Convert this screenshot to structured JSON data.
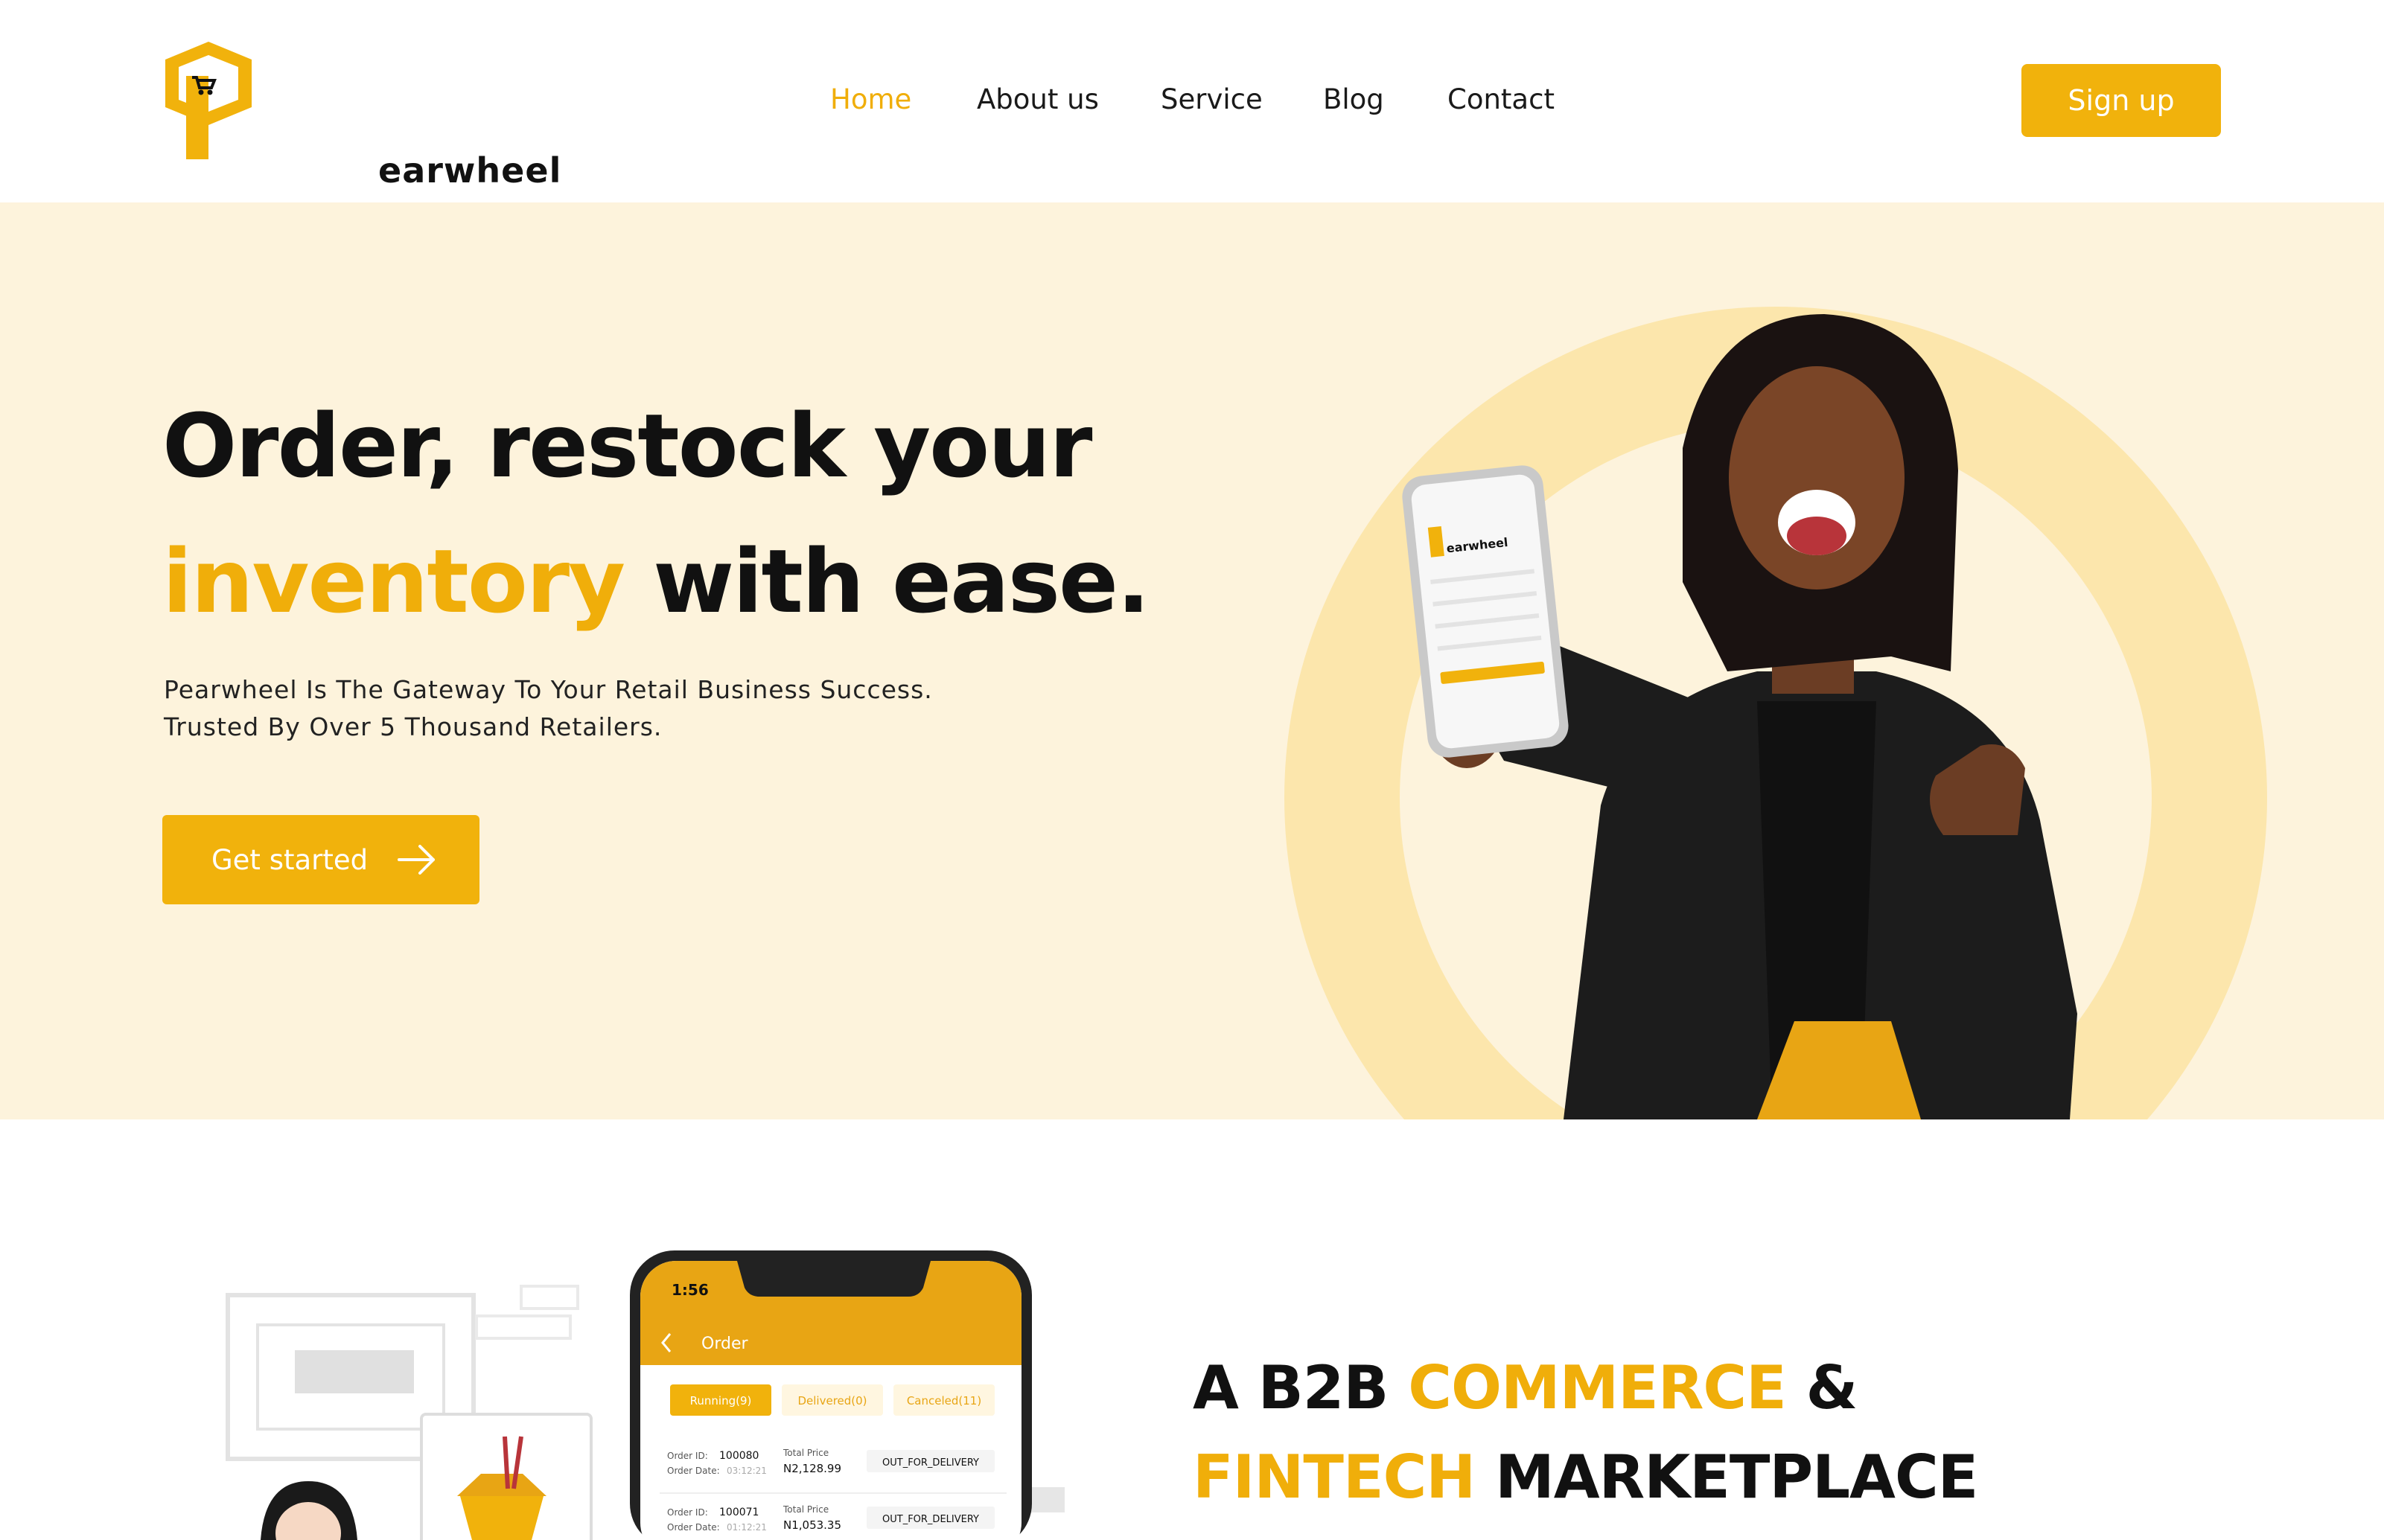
{
  "brand": {
    "name": "earwheel",
    "accent_color": "#f1b20c"
  },
  "nav": {
    "items": [
      {
        "label": "Home",
        "active": true
      },
      {
        "label": "About us",
        "active": false
      },
      {
        "label": "Service",
        "active": false
      },
      {
        "label": "Blog",
        "active": false
      },
      {
        "label": "Contact",
        "active": false
      }
    ],
    "signup_label": "Sign up"
  },
  "hero": {
    "line1": "Order, restock your",
    "line2_accent": "inventory",
    "line2_rest": "with ease.",
    "sub_line1": "Pearwheel Is The Gateway To Your Retail Business Success.",
    "sub_line2": "Trusted By Over 5 Thousand Retailers.",
    "cta_label": "Get started",
    "phone_brand": "earwheel"
  },
  "section2": {
    "title_a": "A B2B ",
    "title_accent1": "COMMERCE",
    "title_b": " &",
    "title_accent2": "FINTECH",
    "title_c": " MARKETPLACE"
  },
  "app_mock": {
    "time": "1:56",
    "title": "Order",
    "tabs": [
      "Running(9)",
      "Delivered(0)",
      "Canceled(11)"
    ],
    "orders": [
      {
        "id_label": "Order ID:",
        "id": "100080",
        "date_label": "Order Date:",
        "date": "03:12:21",
        "price_label": "Total Price",
        "price": "N2,128.99",
        "status": "OUT_FOR_DELIVERY"
      },
      {
        "id_label": "Order ID:",
        "id": "100071",
        "date_label": "Order Date:",
        "date": "01:12:21",
        "price_label": "Total Price",
        "price": "N1,053.35",
        "status": "OUT_FOR_DELIVERY"
      }
    ]
  }
}
